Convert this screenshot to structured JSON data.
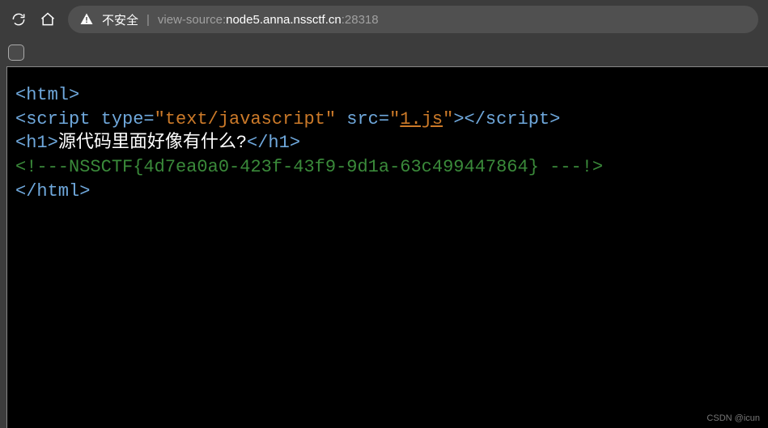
{
  "toolbar": {
    "unsafe_label": "不安全",
    "url_prefix": "view-source:",
    "url_host": "node5.anna.nssctf.cn",
    "url_port": ":28318"
  },
  "source": {
    "line1": {
      "open": "<html>"
    },
    "line2": {
      "open_a": "<script",
      "attr_type_name": " type=",
      "attr_type_val": "\"text/javascript\"",
      "attr_src_name": " src=",
      "attr_src_q1": "\"",
      "attr_src_link": "1.js",
      "attr_src_q2": "\"",
      "open_b": ">",
      "close": "</script>"
    },
    "line3": {
      "open": "<h1>",
      "text": "源代码里面好像有什么?",
      "close": "</h1>"
    },
    "line4": {
      "comment": "<!---NSSCTF{4d7ea0a0-423f-43f9-9d1a-63c499447864} ---!>"
    },
    "line5": {
      "close": "</html>"
    }
  },
  "watermark": "CSDN @icun"
}
